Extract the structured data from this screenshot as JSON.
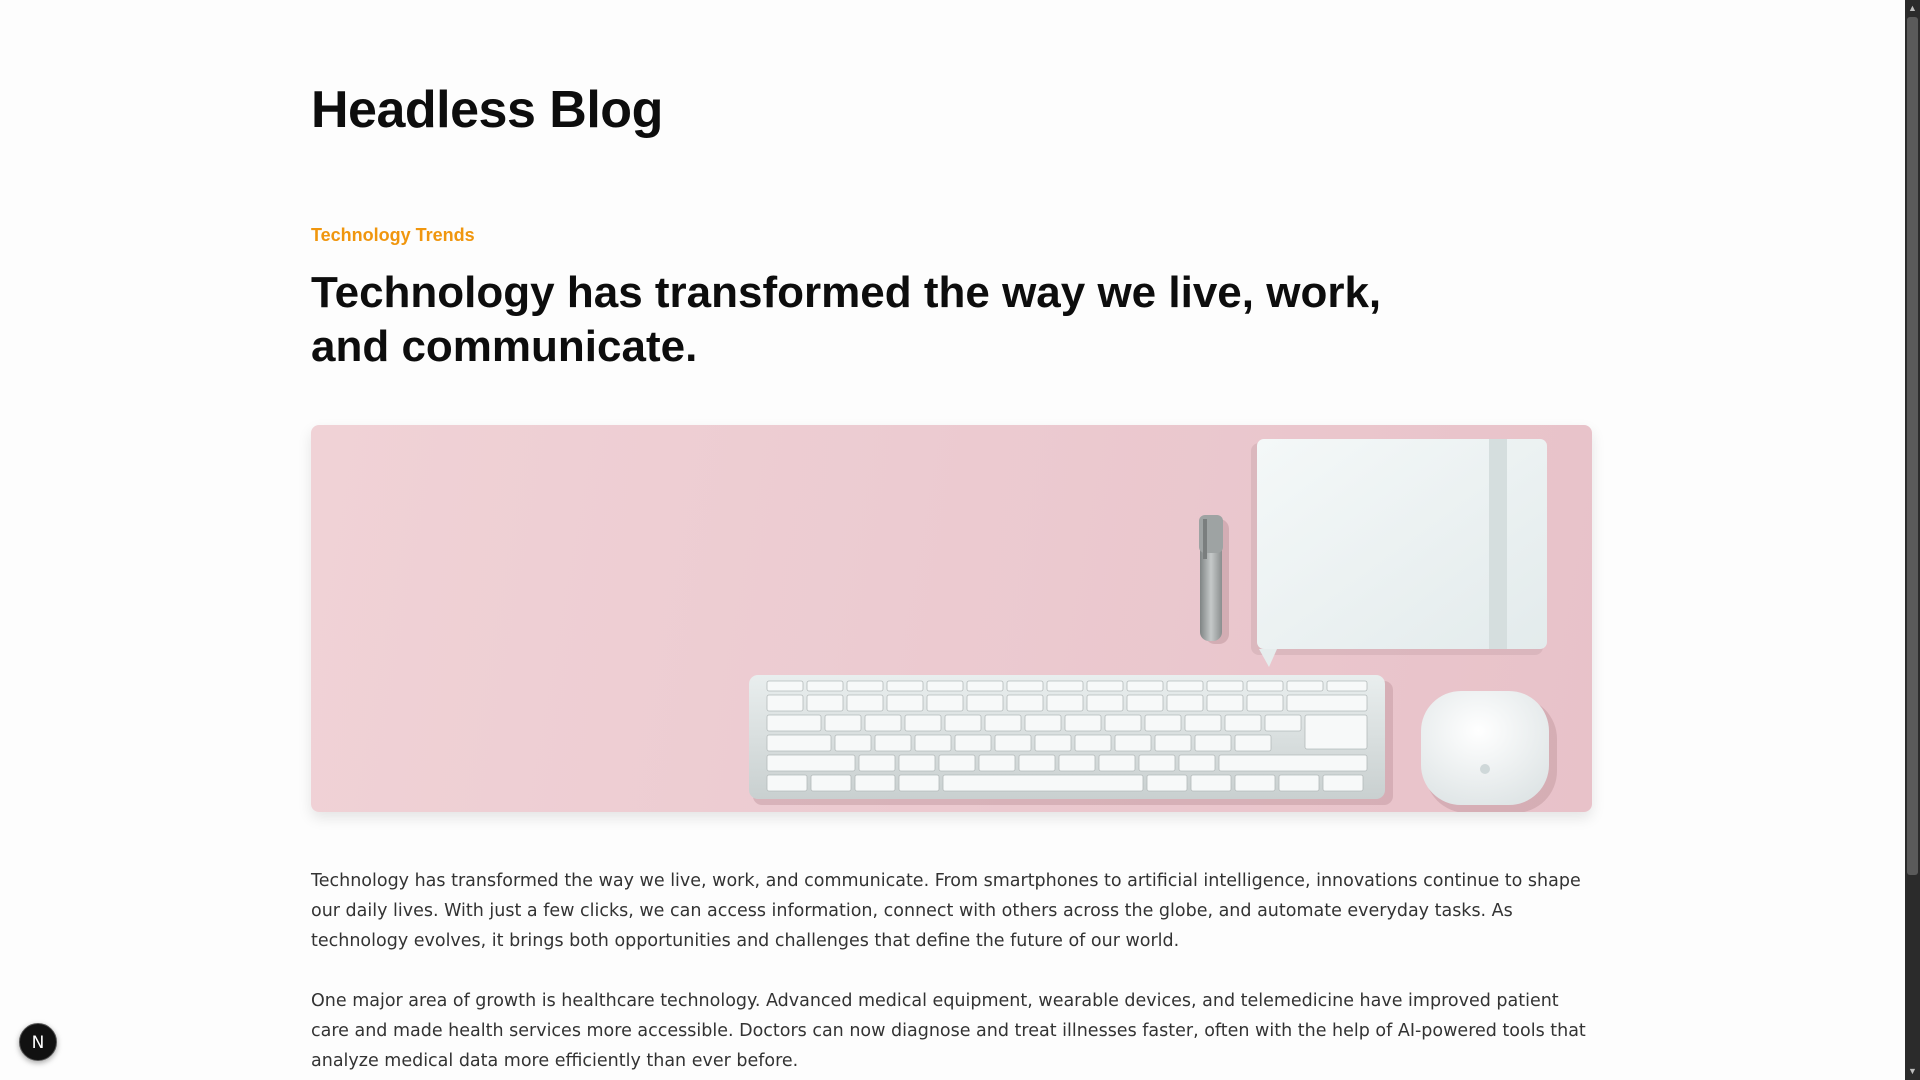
{
  "site": {
    "title": "Headless Blog"
  },
  "post": {
    "category": "Technology Trends",
    "title": "Technology has transformed the way we live, work, and communicate.",
    "hero_image": {
      "description_icon": "desk-keyboard-mouse-notebook-photo"
    },
    "paragraphs": [
      "Technology has transformed the way we live, work, and communicate. From smartphones to artificial intelligence, innovations continue to shape our daily lives. With just a few clicks, we can access information, connect with others across the globe, and automate everyday tasks. As technology evolves, it brings both opportunities and challenges that define the future of our world.",
      "One major area of growth is healthcare technology. Advanced medical equipment, wearable devices, and telemedicine have improved patient care and made health services more accessible. Doctors can now diagnose and treat illnesses faster, often with the help of AI-powered tools that analyze medical data more efficiently than ever before."
    ]
  },
  "dev_badge": {
    "label": "N"
  },
  "scrollbar": {
    "up_glyph": "▲",
    "down_glyph": "▼"
  },
  "colors": {
    "accent": "#f0960e",
    "hero_background": "#ecc9cf",
    "text_primary": "#0d0d0d",
    "text_body": "#333333"
  }
}
